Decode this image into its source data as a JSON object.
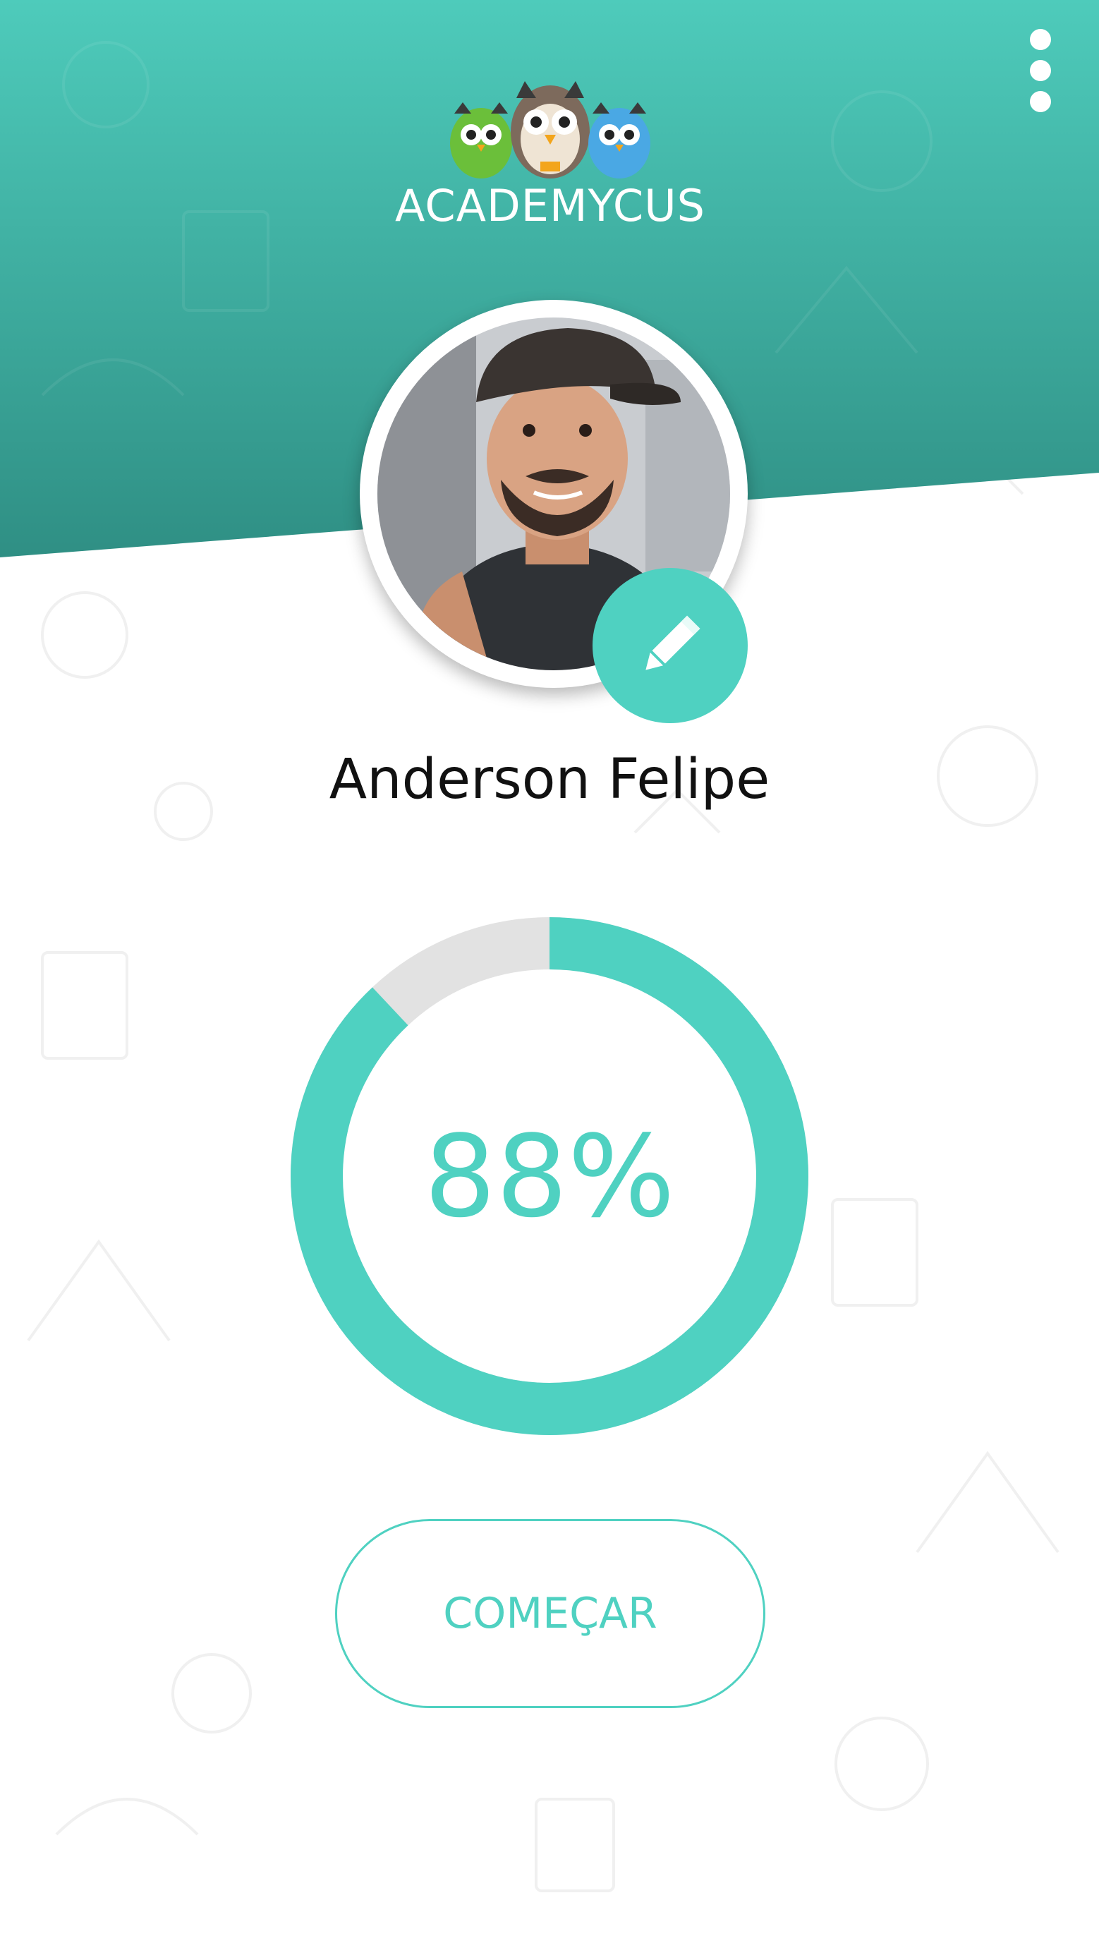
{
  "app": {
    "brand": "ACADEMYCUS"
  },
  "header": {
    "menu_icon": "more-vertical-icon"
  },
  "profile": {
    "name": "Anderson Felipe",
    "avatar_icon": "user-photo",
    "edit_icon": "pencil-icon"
  },
  "progress": {
    "label": "88%",
    "fraction": 0.88
  },
  "actions": {
    "start_label": "COMEÇAR"
  },
  "colors": {
    "accent": "#4fd1c1",
    "header_top": "#4ecbbb",
    "header_bottom": "#2f8f84",
    "track": "#e2e2e2",
    "text": "#111111"
  }
}
